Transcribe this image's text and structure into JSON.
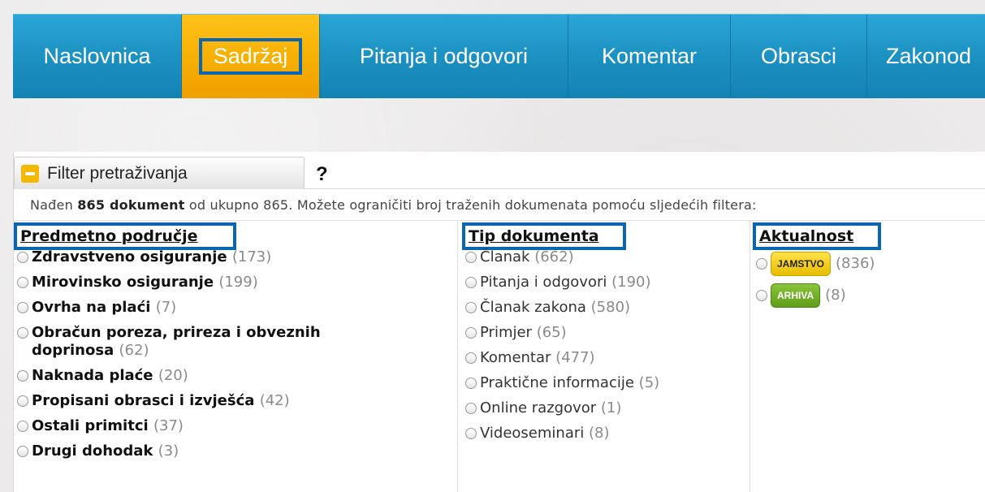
{
  "nav": {
    "items": [
      {
        "label": "Naslovnica"
      },
      {
        "label": "Sadržaj"
      },
      {
        "label": "Pitanja i odgovori"
      },
      {
        "label": "Komentar"
      },
      {
        "label": "Obrasci"
      },
      {
        "label": "Zakonod"
      }
    ],
    "active_index": 1
  },
  "filter": {
    "title": "Filter pretraživanja",
    "help": "?",
    "summary_prefix": "Nađen ",
    "summary_count": "865 dokument",
    "summary_suffix": " od ukupno 865. Možete ograničiti broj traženih dokumenata pomoću sljedećih filtera:"
  },
  "columns": {
    "subject": {
      "heading": "Predmetno područje",
      "options": [
        {
          "label": "Zdravstveno osiguranje",
          "count": "(173)"
        },
        {
          "label": "Mirovinsko osiguranje",
          "count": "(199)"
        },
        {
          "label": "Ovrha na plaći",
          "count": "(7)"
        },
        {
          "label": "Obračun poreza, prireza i obveznih doprinosa",
          "count": "(62)"
        },
        {
          "label": "Naknada plaće",
          "count": "(20)"
        },
        {
          "label": "Propisani obrasci i izvješća",
          "count": "(42)"
        },
        {
          "label": "Ostali primitci",
          "count": "(37)"
        },
        {
          "label": "Drugi dohodak",
          "count": "(3)"
        }
      ]
    },
    "doctype": {
      "heading": "Tip dokumenta",
      "options": [
        {
          "label": "Članak",
          "count": "(662)"
        },
        {
          "label": "Pitanja i odgovori",
          "count": "(190)"
        },
        {
          "label": "Članak zakona",
          "count": "(580)"
        },
        {
          "label": "Primjer",
          "count": "(65)"
        },
        {
          "label": "Komentar",
          "count": "(477)"
        },
        {
          "label": "Praktične informacije",
          "count": "(5)"
        },
        {
          "label": "Online razgovor",
          "count": "(1)"
        },
        {
          "label": "Videoseminari",
          "count": "(8)"
        }
      ]
    },
    "actuality": {
      "heading": "Aktualnost",
      "options": [
        {
          "badge": "JAMSTVO",
          "count": "(836)"
        },
        {
          "badge": "ARHIVA",
          "count": "(8)"
        }
      ]
    }
  },
  "colors": {
    "nav_blue": "#1b8fc0",
    "nav_active": "#f5ad00",
    "highlight": "#0a66b2",
    "badge_gold": "#f0c400",
    "badge_green": "#6aa823"
  }
}
